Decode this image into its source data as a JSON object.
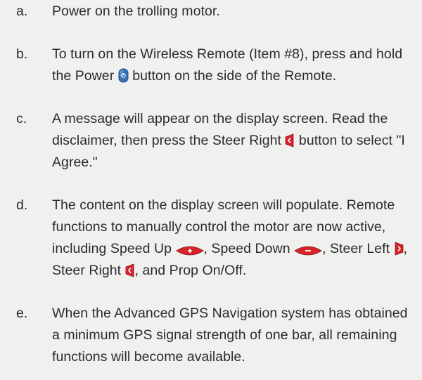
{
  "steps": [
    {
      "marker": "a.",
      "text": "Power on the trolling motor."
    },
    {
      "marker": "b.",
      "text_before_icon": "To turn on the Wireless Remote (Item #8), press and hold the Power",
      "icon": "power-button-icon",
      "text_after_icon": "button on the side of the Remote."
    },
    {
      "marker": "c.",
      "text_before_icon": "A message will appear on the display screen. Read the disclaimer, then press the Steer Right",
      "icon": "steer-right-icon",
      "text_after_icon": "button to select \"I Agree.\""
    },
    {
      "marker": "d.",
      "part1": "The content on the display screen will populate. Remote functions to manually control the motor are now active, including Speed Up",
      "icon1": "speed-up-icon",
      "part2": ", Speed Down",
      "icon2": "speed-down-icon",
      "part3": ", Steer Left",
      "icon3": "steer-left-icon",
      "part4": ", Steer Right",
      "icon4": "steer-right-icon",
      "part5": ", and Prop On/Off."
    },
    {
      "marker": "e.",
      "text": "When the Advanced GPS Navigation system has obtained a minimum GPS signal strength of one bar, all remaining functions will become available."
    }
  ],
  "colors": {
    "background": "#f0f0ef",
    "text": "#2b2b2b",
    "power_blue": "#3a72b6",
    "button_red": "#d8232a"
  }
}
